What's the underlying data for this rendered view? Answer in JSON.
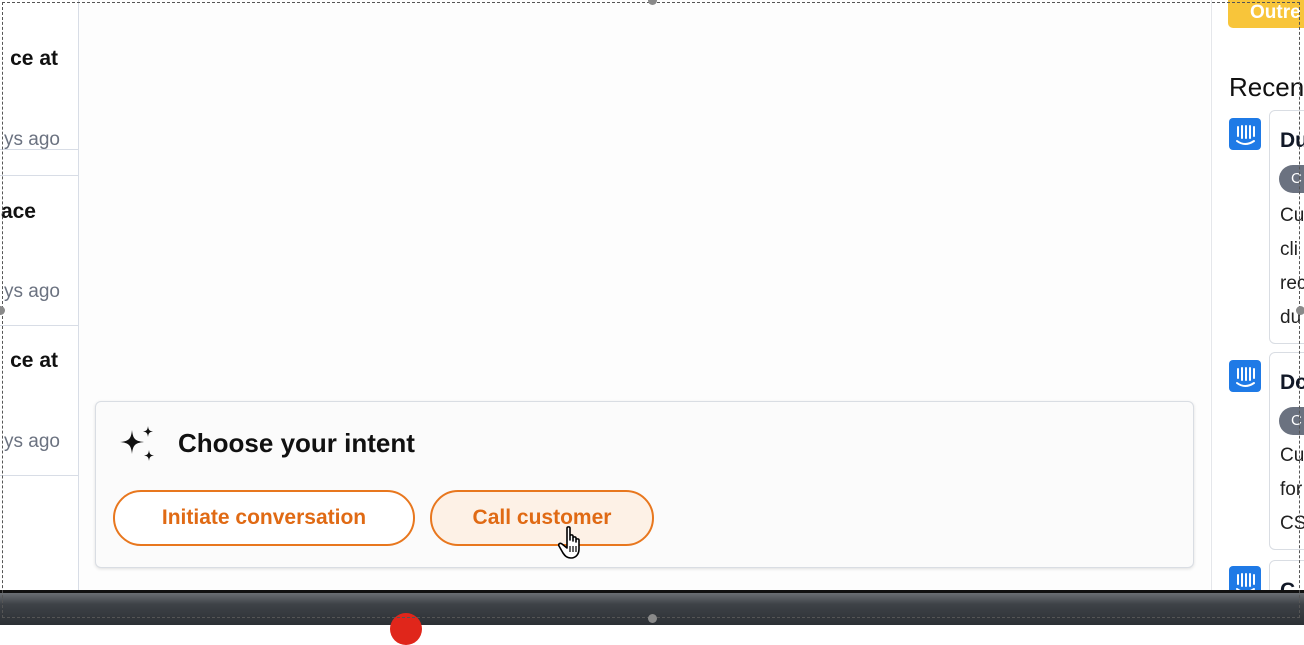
{
  "left_list": {
    "items": [
      {
        "title": "ce at",
        "time": "ys ago"
      },
      {
        "title": "ace",
        "time": "ys ago"
      },
      {
        "title": "ce at",
        "time": "ys ago"
      }
    ]
  },
  "intent": {
    "title": "Choose your intent",
    "icon": "sparkles-icon",
    "actions": [
      {
        "label": "Initiate conversation"
      },
      {
        "label": "Call customer"
      }
    ],
    "accent_color": "#e8771e"
  },
  "right_panel": {
    "chip_label": "Outre",
    "heading": "Recen",
    "cards": [
      {
        "title": "Du",
        "chip": "C",
        "lines": [
          "Cu",
          "cli",
          "rec",
          "du"
        ]
      },
      {
        "title": "Do",
        "chip": "C",
        "lines": [
          "Cu",
          "for",
          "CS"
        ]
      },
      {
        "title": "C",
        "chip": "",
        "lines": []
      }
    ],
    "app_icon": "intercom-icon"
  }
}
